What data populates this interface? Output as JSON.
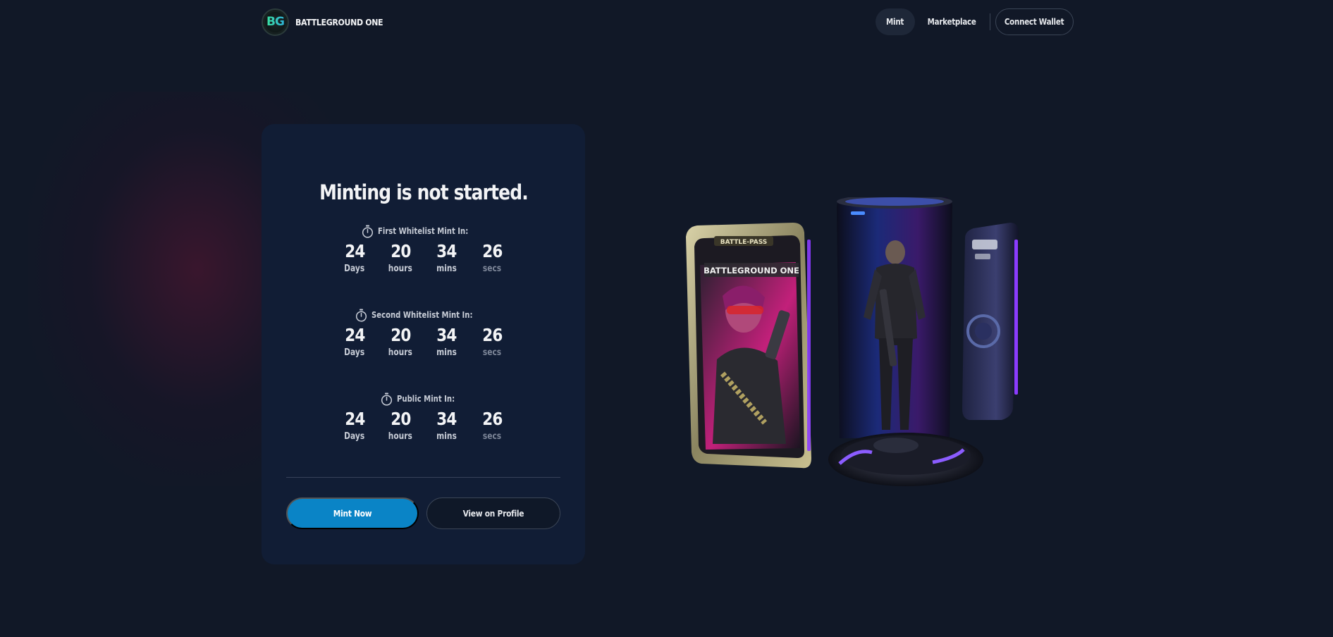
{
  "header": {
    "logo_text": "BG",
    "brand_name": "BATTLEGROUND ONE",
    "nav": [
      {
        "label": "Mint",
        "active": true
      },
      {
        "label": "Marketplace",
        "active": false
      }
    ],
    "connect_wallet_label": "Connect Wallet"
  },
  "card": {
    "title": "Minting is not started.",
    "timers": [
      {
        "label": "First Whitelist Mint In:",
        "days": "24",
        "hours": "20",
        "mins": "34",
        "secs": "26"
      },
      {
        "label": "Second Whitelist Mint In:",
        "days": "24",
        "hours": "20",
        "mins": "34",
        "secs": "26"
      },
      {
        "label": "Public Mint In:",
        "days": "24",
        "hours": "20",
        "mins": "34",
        "secs": "26"
      }
    ],
    "unit_labels": {
      "days": "Days",
      "hours": "hours",
      "mins": "mins",
      "secs": "secs"
    },
    "mint_button": "Mint Now",
    "profile_button": "View on Profile"
  },
  "hero": {
    "battle_pass_label": "BATTLE-PASS",
    "card_title": "BATTLEGROUND ONE"
  },
  "colors": {
    "background": "#111827",
    "card": "#111d35",
    "accent": "#0a84c6",
    "glow_purple": "#8b3cff"
  }
}
